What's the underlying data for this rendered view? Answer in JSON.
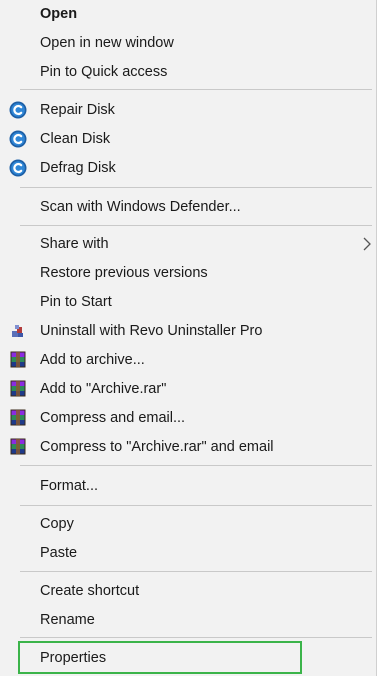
{
  "menu": {
    "items": [
      {
        "label": "Open"
      },
      {
        "label": "Open in new window"
      },
      {
        "label": "Pin to Quick access"
      },
      {
        "label": "Repair Disk",
        "icon": "ccleaner-icon"
      },
      {
        "label": "Clean Disk",
        "icon": "ccleaner-icon"
      },
      {
        "label": "Defrag Disk",
        "icon": "ccleaner-icon"
      },
      {
        "label": "Scan with Windows Defender..."
      },
      {
        "label": "Share with"
      },
      {
        "label": "Restore previous versions"
      },
      {
        "label": "Pin to Start"
      },
      {
        "label": "Uninstall with Revo Uninstaller Pro",
        "icon": "revo-uninstaller-icon"
      },
      {
        "label": "Add to archive...",
        "icon": "winrar-icon"
      },
      {
        "label": "Add to \"Archive.rar\"",
        "icon": "winrar-icon"
      },
      {
        "label": "Compress and email...",
        "icon": "winrar-icon"
      },
      {
        "label": "Compress to \"Archive.rar\" and email",
        "icon": "winrar-icon"
      },
      {
        "label": "Format..."
      },
      {
        "label": "Copy"
      },
      {
        "label": "Paste"
      },
      {
        "label": "Create shortcut"
      },
      {
        "label": "Rename"
      },
      {
        "label": "Properties"
      }
    ],
    "submenu_indicator": "chevron-right-icon",
    "highlight_color": "#3bb44a"
  }
}
